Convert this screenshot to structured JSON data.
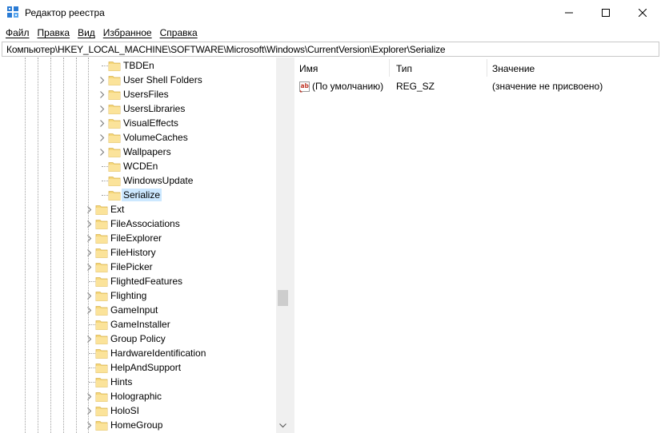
{
  "window": {
    "title": "Редактор реестра",
    "icon": "regedit-icon",
    "controls": [
      "minimize-icon",
      "maximize-icon",
      "close-icon"
    ]
  },
  "menu": [
    "Файл",
    "Правка",
    "Вид",
    "Избранное",
    "Справка"
  ],
  "address": "Компьютер\\HKEY_LOCAL_MACHINE\\SOFTWARE\\Microsoft\\Windows\\CurrentVersion\\Explorer\\Serialize",
  "tree": {
    "items": [
      {
        "label": "TBDEn",
        "level": 2,
        "expandable": false,
        "selected": false
      },
      {
        "label": "User Shell Folders",
        "level": 2,
        "expandable": true,
        "selected": false
      },
      {
        "label": "UsersFiles",
        "level": 2,
        "expandable": true,
        "selected": false
      },
      {
        "label": "UsersLibraries",
        "level": 2,
        "expandable": true,
        "selected": false
      },
      {
        "label": "VisualEffects",
        "level": 2,
        "expandable": true,
        "selected": false
      },
      {
        "label": "VolumeCaches",
        "level": 2,
        "expandable": true,
        "selected": false
      },
      {
        "label": "Wallpapers",
        "level": 2,
        "expandable": true,
        "selected": false
      },
      {
        "label": "WCDEn",
        "level": 2,
        "expandable": false,
        "selected": false
      },
      {
        "label": "WindowsUpdate",
        "level": 2,
        "expandable": false,
        "selected": false
      },
      {
        "label": "Serialize",
        "level": 2,
        "expandable": false,
        "selected": true
      },
      {
        "label": "Ext",
        "level": 1,
        "expandable": true,
        "selected": false
      },
      {
        "label": "FileAssociations",
        "level": 1,
        "expandable": true,
        "selected": false
      },
      {
        "label": "FileExplorer",
        "level": 1,
        "expandable": true,
        "selected": false
      },
      {
        "label": "FileHistory",
        "level": 1,
        "expandable": true,
        "selected": false
      },
      {
        "label": "FilePicker",
        "level": 1,
        "expandable": true,
        "selected": false
      },
      {
        "label": "FlightedFeatures",
        "level": 1,
        "expandable": false,
        "selected": false
      },
      {
        "label": "Flighting",
        "level": 1,
        "expandable": true,
        "selected": false
      },
      {
        "label": "GameInput",
        "level": 1,
        "expandable": true,
        "selected": false
      },
      {
        "label": "GameInstaller",
        "level": 1,
        "expandable": false,
        "selected": false
      },
      {
        "label": "Group Policy",
        "level": 1,
        "expandable": true,
        "selected": false
      },
      {
        "label": "HardwareIdentification",
        "level": 1,
        "expandable": false,
        "selected": false
      },
      {
        "label": "HelpAndSupport",
        "level": 1,
        "expandable": false,
        "selected": false
      },
      {
        "label": "Hints",
        "level": 1,
        "expandable": false,
        "selected": false
      },
      {
        "label": "Holographic",
        "level": 1,
        "expandable": true,
        "selected": false
      },
      {
        "label": "HoloSI",
        "level": 1,
        "expandable": true,
        "selected": false
      },
      {
        "label": "HomeGroup",
        "level": 1,
        "expandable": true,
        "selected": false
      }
    ]
  },
  "list": {
    "columns": [
      "Имя",
      "Тип",
      "Значение"
    ],
    "rows": [
      {
        "icon": "string-value-icon",
        "name": "(По умолчанию)",
        "type": "REG_SZ",
        "value": "(значение не присвоено)"
      }
    ]
  },
  "colors": {
    "selection": "#cce8ff",
    "folder": "#f5d77a",
    "scrollbar_track": "#f0f0f0"
  }
}
